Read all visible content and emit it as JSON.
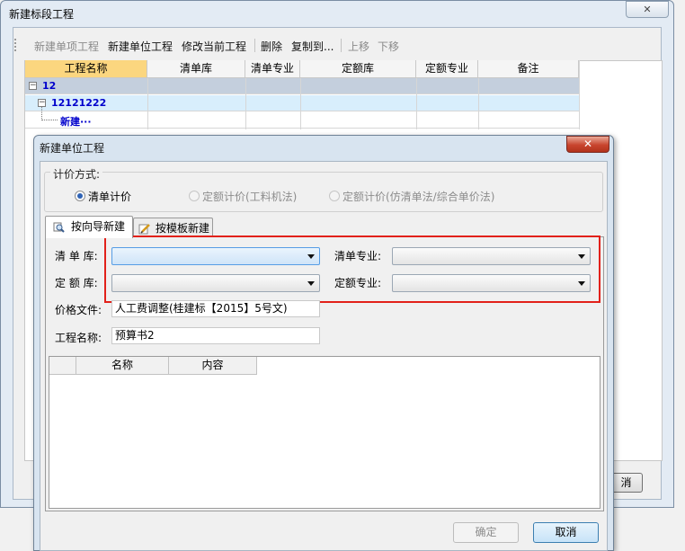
{
  "back_window": {
    "title": "新建标段工程",
    "close_glyph": "✕",
    "toolbar": {
      "new_item": "新建单项工程",
      "new_unit": "新建单位工程",
      "modify": "修改当前工程",
      "delete": "删除",
      "copy_to": "复制到...",
      "move_up": "上移",
      "move_down": "下移"
    },
    "columns": [
      "工程名称",
      "清单库",
      "清单专业",
      "定额库",
      "定额专业",
      "备注"
    ],
    "tree": [
      {
        "label": "12",
        "toggle": "−"
      },
      {
        "label": "12121222",
        "toggle": "−"
      },
      {
        "label": "新建···"
      }
    ],
    "cancel_partial": "消"
  },
  "dialog": {
    "title": "新建单位工程",
    "close_glyph": "✕",
    "pricing_group_label": "计价方式:",
    "pricing_options": [
      {
        "label": "清单计价",
        "selected": true,
        "enabled": true
      },
      {
        "label": "定额计价(工料机法)",
        "selected": false,
        "enabled": false
      },
      {
        "label": "定额计价(仿清单法/综合单价法)",
        "selected": false,
        "enabled": false
      }
    ],
    "tabs": [
      {
        "label": "按向导新建",
        "icon": "magnifier-icon",
        "active": true
      },
      {
        "label": "按模板新建",
        "icon": "pencil-icon",
        "active": false
      }
    ],
    "fields": {
      "bill_lib_label": "清 单 库:",
      "bill_lib_value": "",
      "bill_spec_label": "清单专业:",
      "bill_spec_value": "",
      "quota_lib_label": "定 额 库:",
      "quota_lib_value": "",
      "quota_spec_label": "定额专业:",
      "quota_spec_value": "",
      "price_file_label": "价格文件:",
      "price_file_value": "人工费调整(桂建标【2015】5号文)",
      "project_name_label": "工程名称:",
      "project_name_value": "预算书2"
    },
    "sub_columns": [
      "",
      "名称",
      "内容"
    ],
    "buttons": {
      "ok": "确定",
      "cancel": "取消"
    },
    "highlight_color": "#e2211a"
  }
}
